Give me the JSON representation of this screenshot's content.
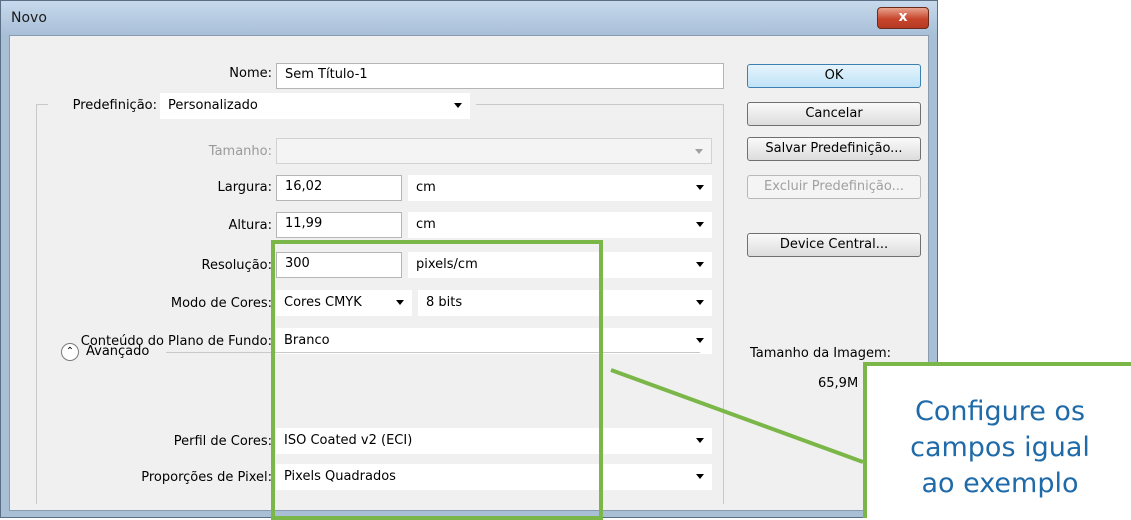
{
  "window": {
    "title": "Novo",
    "close_label": "x"
  },
  "form": {
    "nome": {
      "label": "Nome:",
      "value": "Sem Título-1"
    },
    "predefinicao": {
      "label": "Predefinição:",
      "value": "Personalizado"
    },
    "tamanho": {
      "label": "Tamanho:",
      "value": ""
    },
    "largura": {
      "label": "Largura:",
      "value": "16,02",
      "unit": "cm"
    },
    "altura": {
      "label": "Altura:",
      "value": "11,99",
      "unit": "cm"
    },
    "resolucao": {
      "label": "Resolução:",
      "value": "300",
      "unit": "pixels/cm"
    },
    "modo": {
      "label": "Modo de Cores:",
      "value": "Cores CMYK",
      "bits": "8 bits"
    },
    "conteudo": {
      "label": "Conteúdo do Plano de Fundo:",
      "value": "Branco"
    },
    "avancado": {
      "label": "Avançado"
    },
    "perfil": {
      "label": "Perfil de Cores:",
      "value": "ISO Coated v2 (ECI)"
    },
    "proporcoes": {
      "label": "Proporções de Pixel:",
      "value": "Pixels Quadrados"
    }
  },
  "buttons": {
    "ok": "OK",
    "cancelar": "Cancelar",
    "salvar": "Salvar Predefinição...",
    "excluir": "Excluir Predefinição...",
    "device": "Device Central..."
  },
  "image_size": {
    "label": "Tamanho da Imagem:",
    "value": "65,9M"
  },
  "annotation": {
    "text": "Configure os\ncampos igual\nao exemplo",
    "accent_color": "#7ab648",
    "text_color": "#1f6aa8"
  }
}
